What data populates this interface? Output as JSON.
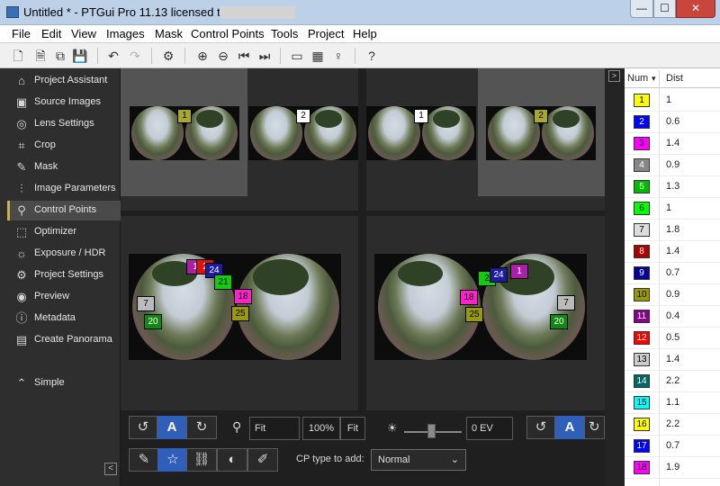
{
  "window": {
    "title": "Untitled * - PTGui Pro 11.13 licensed to",
    "min": "—",
    "max": "☐",
    "close": "✕"
  },
  "menu": [
    "File",
    "Edit",
    "View",
    "Images",
    "Mask",
    "Control Points",
    "Tools",
    "Project",
    "Help"
  ],
  "toolbar_icons": [
    "new-document-icon",
    "open-document-icon",
    "copy-document-icon",
    "save-icon",
    "undo-icon",
    "redo-icon",
    "settings-icon",
    "zoom-in-icon",
    "zoom-out-icon",
    "previous-icon",
    "next-icon",
    "panorama-editor-icon",
    "table-icon",
    "lightbulb-icon",
    "help-icon"
  ],
  "sidebar": {
    "items": [
      {
        "label": "Project Assistant",
        "icon": "⌂"
      },
      {
        "label": "Source Images",
        "icon": "▣"
      },
      {
        "label": "Lens Settings",
        "icon": "◎"
      },
      {
        "label": "Crop",
        "icon": "⌗"
      },
      {
        "label": "Mask",
        "icon": "✎"
      },
      {
        "label": "Image Parameters",
        "icon": "⫶"
      },
      {
        "label": "Control Points",
        "icon": "⚲"
      },
      {
        "label": "Optimizer",
        "icon": "⬚"
      },
      {
        "label": "Exposure / HDR",
        "icon": "☼"
      },
      {
        "label": "Project Settings",
        "icon": "⚙"
      },
      {
        "label": "Preview",
        "icon": "◉"
      },
      {
        "label": "Metadata",
        "icon": "ⓘ"
      },
      {
        "label": "Create Panorama",
        "icon": "▤"
      }
    ],
    "active_index": 6,
    "simple": {
      "label": "Simple",
      "icon": "⌃"
    },
    "collapse": "<"
  },
  "thumbnails": {
    "left": [
      {
        "label": "1"
      },
      {
        "label": "2"
      }
    ],
    "right": [
      {
        "label": "1"
      },
      {
        "label": "2"
      }
    ]
  },
  "control_points": {
    "left": [
      {
        "label": "1",
        "color": "#aa1faa"
      },
      {
        "label": "2",
        "color": "#dd1111"
      },
      {
        "label": "24",
        "color": "#1c1ca0"
      },
      {
        "label": "21",
        "color": "#11cc11"
      },
      {
        "label": "7",
        "color": "#bbbbbb"
      },
      {
        "label": "20",
        "color": "#118811"
      },
      {
        "label": "18",
        "color": "#ff22cc"
      },
      {
        "label": "25",
        "color": "#999911"
      }
    ],
    "right": [
      {
        "label": "2",
        "color": "#11cc11"
      },
      {
        "label": "24",
        "color": "#1c1ca0"
      },
      {
        "label": "1",
        "color": "#aa1faa"
      },
      {
        "label": "18",
        "color": "#ff22cc"
      },
      {
        "label": "25",
        "color": "#999911"
      },
      {
        "label": "7",
        "color": "#bbbbbb"
      },
      {
        "label": "20",
        "color": "#118811"
      }
    ]
  },
  "controls": {
    "rotate_ccw": "↺",
    "auto_a": "A",
    "rotate_cw": "↻",
    "zoom_value": "Fit",
    "zoom_100": "100%",
    "zoom_fit": "Fit",
    "brightness_icon": "☀",
    "ev_value": "0 EV",
    "cp_type_label": "CP type to add:",
    "cp_type_value": "Normal",
    "cp_type_chevron": "⌄"
  },
  "cp_table": {
    "headers": {
      "num": "Num",
      "sort_arrow": "▾",
      "dist": "Dist"
    },
    "expander": ">",
    "rows": [
      {
        "num": "1",
        "color": "#ffff00",
        "dist": "1"
      },
      {
        "num": "2",
        "color": "#0000ff",
        "dist": "0.6"
      },
      {
        "num": "3",
        "color": "#ff00ff",
        "dist": "1.4"
      },
      {
        "num": "4",
        "color": "#888888",
        "dist": "0.9"
      },
      {
        "num": "5",
        "color": "#00bb00",
        "dist": "1.3"
      },
      {
        "num": "6",
        "color": "#00ff00",
        "dist": "1"
      },
      {
        "num": "7",
        "color": "#dddddd",
        "dist": "1.8"
      },
      {
        "num": "8",
        "color": "#aa0000",
        "dist": "1.4"
      },
      {
        "num": "9",
        "color": "#000099",
        "dist": "0.7"
      },
      {
        "num": "10",
        "color": "#999900",
        "dist": "0.9"
      },
      {
        "num": "11",
        "color": "#880088",
        "dist": "0.4"
      },
      {
        "num": "12",
        "color": "#ff0000",
        "dist": "0.5"
      },
      {
        "num": "13",
        "color": "#cccccc",
        "dist": "1.4"
      },
      {
        "num": "14",
        "color": "#006666",
        "dist": "2.2"
      },
      {
        "num": "15",
        "color": "#00ffff",
        "dist": "1.1"
      },
      {
        "num": "16",
        "color": "#ffff00",
        "dist": "2.2"
      },
      {
        "num": "17",
        "color": "#0000ff",
        "dist": "0.7"
      },
      {
        "num": "18",
        "color": "#ff00ff",
        "dist": "1.9"
      }
    ]
  }
}
